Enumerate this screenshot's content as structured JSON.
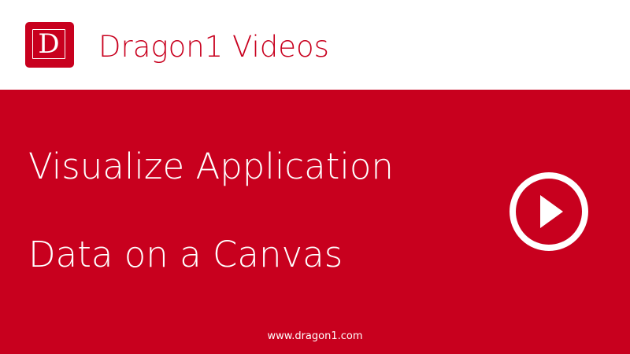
{
  "header": {
    "logo_letter": "D",
    "title": "Dragon1 Videos"
  },
  "content": {
    "headline_line_1": "Visualize Application",
    "headline_line_2": "Data on a Canvas"
  },
  "controls": {
    "play_icon": "play-circle-icon"
  },
  "footer": {
    "url": "www.dragon1.com"
  },
  "colors": {
    "brand_red": "#c8001e",
    "text_light": "#ffffff",
    "background": "#ffffff"
  }
}
